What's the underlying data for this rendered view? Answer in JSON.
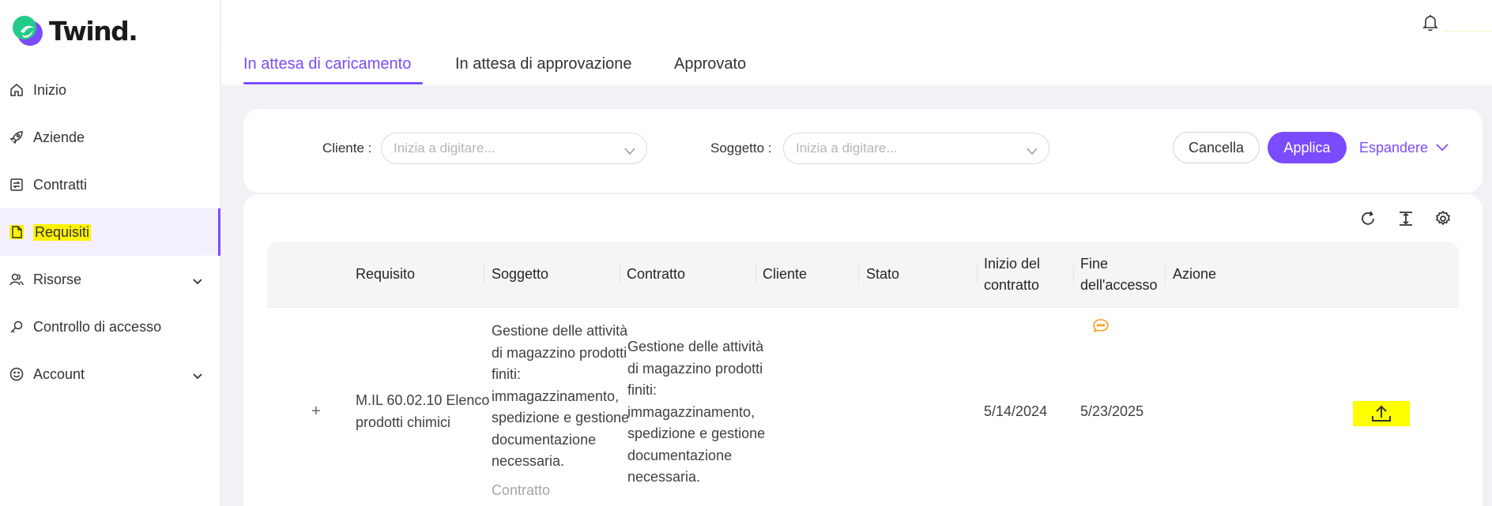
{
  "app": {
    "name": "Twind."
  },
  "sidebar": {
    "items": [
      {
        "label": "Inizio",
        "icon": "home-icon"
      },
      {
        "label": "Aziende",
        "icon": "rocket-icon"
      },
      {
        "label": "Contratti",
        "icon": "contract-icon"
      },
      {
        "label": "Requisiti",
        "icon": "file-icon",
        "active": true
      },
      {
        "label": "Risorse",
        "icon": "users-icon",
        "expandable": true
      },
      {
        "label": "Controllo di accesso",
        "icon": "key-icon"
      },
      {
        "label": "Account",
        "icon": "smile-icon",
        "expandable": true
      }
    ]
  },
  "tabs": [
    {
      "label": "In attesa di caricamento",
      "active": true
    },
    {
      "label": "In attesa di approvazione"
    },
    {
      "label": "Approvato"
    }
  ],
  "filters": {
    "cliente_label": "Cliente",
    "cliente_placeholder": "Inizia a digitare...",
    "soggetto_label": "Soggetto",
    "soggetto_placeholder": "Inizia a digitare...",
    "cancel": "Cancella",
    "apply": "Applica",
    "expand": "Espandere"
  },
  "table": {
    "headers": {
      "requisito": "Requisito",
      "soggetto": "Soggetto",
      "contratto": "Contratto",
      "cliente": "Cliente",
      "stato": "Stato",
      "inizio_line1": "Inizio del",
      "inizio_line2": "contratto",
      "fine_line1": "Fine",
      "fine_line2": "dell'accesso",
      "azione": "Azione"
    },
    "rows": [
      {
        "expand": "+",
        "requisito_l1": "M.IL 60.02.10 Elenco",
        "requisito_l2": "prodotti chimici",
        "soggetto_lines": [
          "Gestione delle attività",
          "di magazzino prodotti",
          "finiti:",
          "immagazzinamento,",
          "spedizione e gestione",
          "documentazione",
          "necessaria."
        ],
        "soggetto_type": "Contratto",
        "contratto_lines": [
          "Gestione delle attività",
          "di magazzino prodotti",
          "finiti:",
          "immagazzinamento,",
          "spedizione e gestione",
          "documentazione",
          "necessaria."
        ],
        "cliente": "",
        "inizio": "5/14/2024",
        "fine": "5/23/2025"
      }
    ]
  },
  "colors": {
    "accent": "#7b4bff",
    "highlight": "#fff200",
    "comment": "#f0a020"
  }
}
